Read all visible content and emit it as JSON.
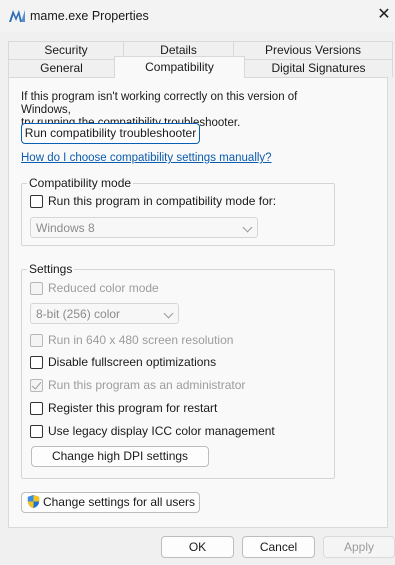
{
  "window": {
    "title": "mame.exe Properties",
    "close_glyph": "✕"
  },
  "tabs_top_row": [
    {
      "label": "Security"
    },
    {
      "label": "Details"
    },
    {
      "label": "Previous Versions"
    }
  ],
  "tabs_bottom_row": [
    {
      "label": "General"
    },
    {
      "label": "Compatibility",
      "active": true
    },
    {
      "label": "Digital Signatures"
    }
  ],
  "compat": {
    "intro_line1": "If this program isn't working correctly on this version of Windows,",
    "intro_line2": "try running the compatibility troubleshooter.",
    "troubleshooter_button": "Run compatibility troubleshooter",
    "help_link": "How do I choose compatibility settings manually?",
    "mode_group": {
      "label": "Compatibility mode",
      "checkbox_label": "Run this program in compatibility mode for:",
      "checked": false,
      "os_select_value": "Windows 8",
      "os_select_enabled": false
    },
    "settings_group": {
      "label": "Settings",
      "reduced_color": {
        "label": "Reduced color mode",
        "checked": false,
        "enabled": false
      },
      "color_select_value": "8-bit (256) color",
      "res_640": {
        "label": "Run in 640 x 480 screen resolution",
        "checked": false,
        "enabled": false
      },
      "disable_fullscreen": {
        "label": "Disable fullscreen optimizations",
        "checked": false,
        "enabled": true
      },
      "run_as_admin": {
        "label": "Run this program as an administrator",
        "checked": true,
        "enabled": false
      },
      "register_restart": {
        "label": "Register this program for restart",
        "checked": false,
        "enabled": true
      },
      "legacy_icc": {
        "label": "Use legacy display ICC color management",
        "checked": false,
        "enabled": true
      },
      "dpi_button": "Change high DPI settings"
    },
    "all_users_button": "Change settings for all users",
    "all_users_icon": "uac-shield-icon"
  },
  "footer": {
    "ok": "OK",
    "cancel": "Cancel",
    "apply": "Apply",
    "apply_enabled": false
  },
  "colors": {
    "accent_link": "#0b5cad",
    "focus_border": "#0a5fb4",
    "disabled_text": "#9c9c9c"
  }
}
